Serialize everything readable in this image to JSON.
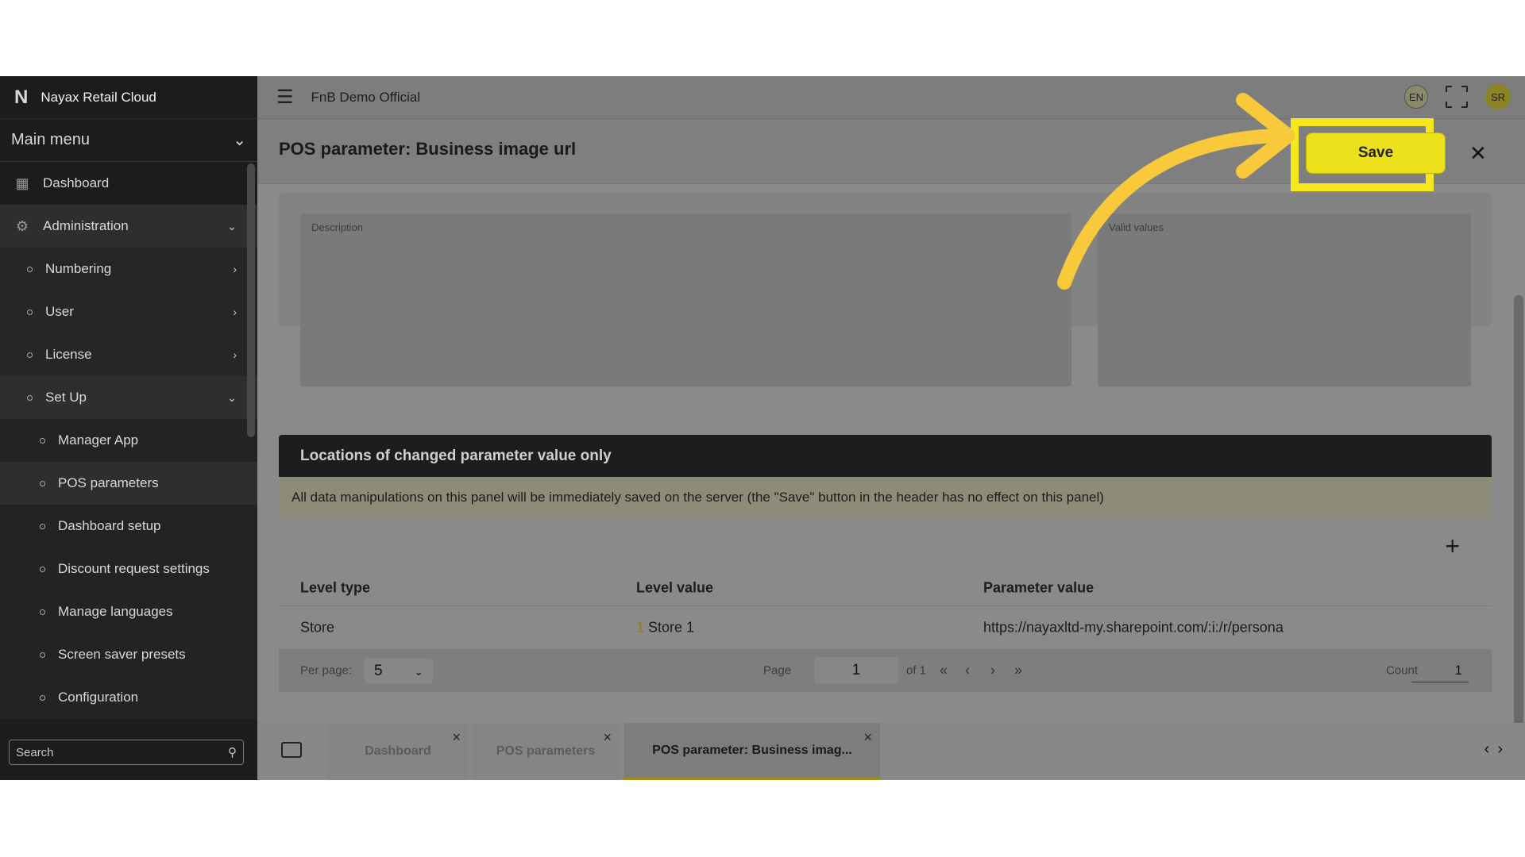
{
  "app": {
    "title": "Nayax Retail Cloud",
    "workspace": "FnB Demo Official"
  },
  "sidebar": {
    "main_menu_label": "Main menu",
    "items": [
      {
        "label": "Dashboard",
        "icon": "dashboard-icon"
      },
      {
        "label": "Administration",
        "icon": "settings-icon"
      },
      {
        "label": "Numbering"
      },
      {
        "label": "User"
      },
      {
        "label": "License"
      },
      {
        "label": "Set Up"
      },
      {
        "label": "Manager App"
      },
      {
        "label": "POS parameters"
      },
      {
        "label": "Dashboard setup"
      },
      {
        "label": "Discount request settings"
      },
      {
        "label": "Manage languages"
      },
      {
        "label": "Screen saver presets"
      },
      {
        "label": "Configuration"
      }
    ],
    "search_placeholder": "Search"
  },
  "header": {
    "lang": "EN",
    "avatar": "SR"
  },
  "page": {
    "title": "POS parameter: Business image url",
    "save_label": "Save",
    "description_label": "Description",
    "valid_values_label": "Valid values"
  },
  "locations": {
    "title": "Locations of changed parameter value only",
    "notice": "All data manipulations on this panel will be immediately saved on the server (the \"Save\" button in the header has no effect on this panel)",
    "columns": [
      "Level type",
      "Level value",
      "Parameter value"
    ],
    "rows": [
      {
        "level_type": "Store",
        "level_id": "1",
        "level_value": "Store 1",
        "parameter_value": "https://nayaxltd-my.sharepoint.com/:i:/r/persona"
      }
    ],
    "pager": {
      "per_page_label": "Per page:",
      "per_page_value": "5",
      "page_label": "Page",
      "page_value": "1",
      "of_label": "of 1",
      "count_label": "Count",
      "count_value": "1"
    }
  },
  "tabs": [
    {
      "label": "Dashboard"
    },
    {
      "label": "POS parameters"
    },
    {
      "label": "POS parameter: Business imag..."
    }
  ],
  "colors": {
    "highlight": "#f7e81e",
    "arrow": "#f9c93c"
  }
}
